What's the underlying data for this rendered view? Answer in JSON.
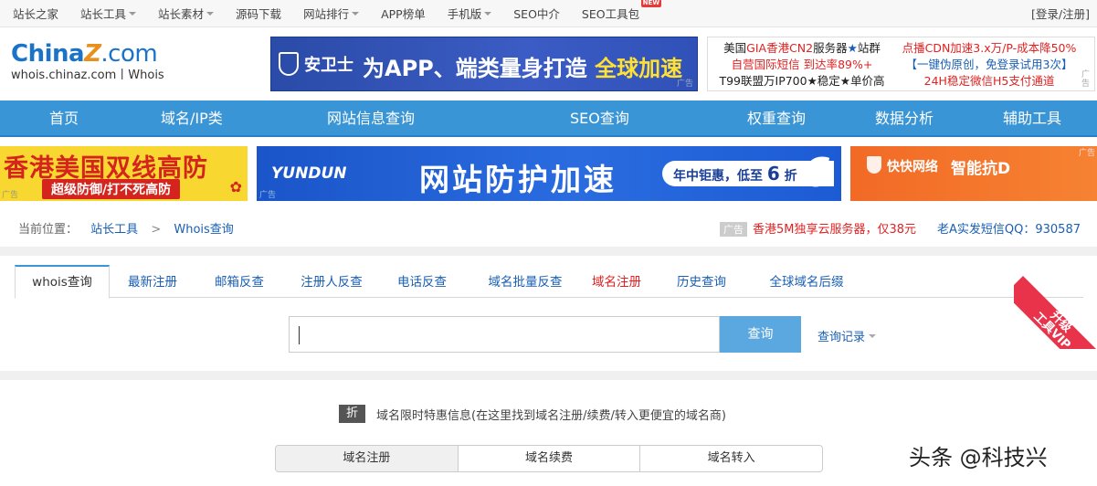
{
  "topbar": {
    "links": [
      {
        "label": "站长之家",
        "caret": false
      },
      {
        "label": "站长工具",
        "caret": true
      },
      {
        "label": "站长素材",
        "caret": true
      },
      {
        "label": "源码下载",
        "caret": false
      },
      {
        "label": "网站排行",
        "caret": true
      },
      {
        "label": "APP榜单",
        "caret": false
      },
      {
        "label": "手机版",
        "caret": true
      },
      {
        "label": "SEO中介",
        "caret": false
      },
      {
        "label": "SEO工具包",
        "caret": false,
        "badge": "NEW"
      }
    ],
    "login": "[登录/注册]"
  },
  "logo": {
    "brand_a": "China",
    "brand_z": "Z",
    "brand_com": ".com",
    "sub": "whois.chinaz.com丨Whois"
  },
  "ad_banner": {
    "brand": "安卫士",
    "slogan": "为APP、端类量身打造",
    "highlight": "全球加速",
    "tag": "广告"
  },
  "text_ads": {
    "col1": [
      "美国GIA香港CN2服务器★站群",
      "自营国际短信 到达率89%+",
      "T99联盟万IP700★稳定★单价高"
    ],
    "col2": [
      "点播CDN加速3.x万/P-成本降50%",
      "【一键伪原创，免登录试用3次】",
      "24H稳定微信H5支付通道"
    ],
    "tag": "广告"
  },
  "nav": [
    "首页",
    "域名/IP类",
    "网站信息查询",
    "SEO查询",
    "权重查询",
    "数据分析",
    "辅助工具"
  ],
  "ad_row2": {
    "left": {
      "title": "香港美国双线高防",
      "sub": "超级防御/打不死高防",
      "tag": "广告"
    },
    "mid": {
      "brand": "YUNDUN",
      "title": "网站防护加速",
      "promo_a": "年中钜惠，低至",
      "promo_b": "6",
      "promo_c": "折",
      "big6": "6",
      "tag": "广告"
    },
    "right": {
      "brand": "快快网络",
      "title": "智能抗D",
      "tag": "广告"
    }
  },
  "breadcrumb": {
    "prefix": "当前位置：",
    "item1": "站长工具",
    "sep": ">",
    "item2": "Whois查询"
  },
  "notice": {
    "tag": "广告",
    "ad_text": "香港5M独享云服务器，仅38元",
    "qq_text": "老A实发短信QQ：930587"
  },
  "tabs": [
    "whois查询",
    "最新注册",
    "邮箱反查",
    "注册人反查",
    "电话反查",
    "域名批量反查",
    "域名注册",
    "历史查询",
    "全球域名后缀"
  ],
  "vip": {
    "label": "升级\n工具VIP"
  },
  "search": {
    "value": "",
    "button": "查询",
    "history": "查询记录"
  },
  "promo": {
    "badge": "折",
    "text": "域名限时特惠信息(在这里找到域名注册/续费/转入更便宜的域名商)"
  },
  "segments": [
    "域名注册",
    "域名续费",
    "域名转入"
  ],
  "watermark": "头条 @科技兴"
}
